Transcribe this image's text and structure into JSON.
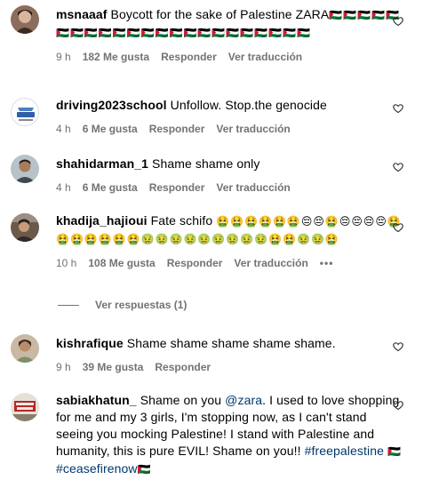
{
  "comments": [
    {
      "username": "msnaaaf",
      "text": "Boycott for the sake of Palestine ZARA",
      "emojis": "🇵🇸🇵🇸🇵🇸🇵🇸🇵🇸🇵🇸🇵🇸🇵🇸🇵🇸🇵🇸🇵🇸🇵🇸🇵🇸🇵🇸🇵🇸🇵🇸🇵🇸🇵🇸🇵🇸🇵🇸🇵🇸🇵🇸🇵🇸",
      "time": "9 h",
      "likes": "182 Me gusta",
      "reply": "Responder",
      "translate": "Ver traducción"
    },
    {
      "username": "driving2023school",
      "text": "Unfollow. Stop.the genocide",
      "time": "4 h",
      "likes": "6 Me gusta",
      "reply": "Responder",
      "translate": "Ver traducción",
      "avatar_text": "DRIVING"
    },
    {
      "username": "shahidarman_1",
      "text": "Shame shame only",
      "time": "4 h",
      "likes": "6 Me gusta",
      "reply": "Responder",
      "translate": "Ver traducción"
    },
    {
      "username": "khadija_hajioui",
      "text": "Fate schifo",
      "emojis": "🤮🤮🤮🤮🤮🤮😔😔🤮😔😔😔😔🤮🤮🤮🤮🤮🤮🤮🤢🤢🤢🤢🤢🤢🤢🤢🤢🤮🤮🤢🤢🤮",
      "time": "10 h",
      "likes": "108 Me gusta",
      "reply": "Responder",
      "translate": "Ver traducción",
      "more": "•••"
    },
    {
      "username": "kishrafique",
      "text": "Shame shame shame shame shame.",
      "time": "9 h",
      "likes": "39 Me gusta",
      "reply": "Responder"
    },
    {
      "username": "sabiakhatun_",
      "text_1": "Shame on you",
      "mention": "@zara",
      "text_2": ". I used to love shopping for me and my 3 girls, I'm stopping now, as I can't stand seeing you mocking Palestine! I stand with Palestine and humanity, this is pure EVIL! Shame on you!!",
      "hashtag_1": "#freepalestine",
      "flag_1": "🇵🇸",
      "hashtag_2": "#ceasefirenow",
      "flag_2": "🇵🇸",
      "avatar_text": "ENOUGH"
    }
  ],
  "view_replies": "Ver respuestas (1)",
  "colors": {
    "meta": "#737373",
    "link": "#00376b",
    "heart_stroke": "#262626"
  }
}
